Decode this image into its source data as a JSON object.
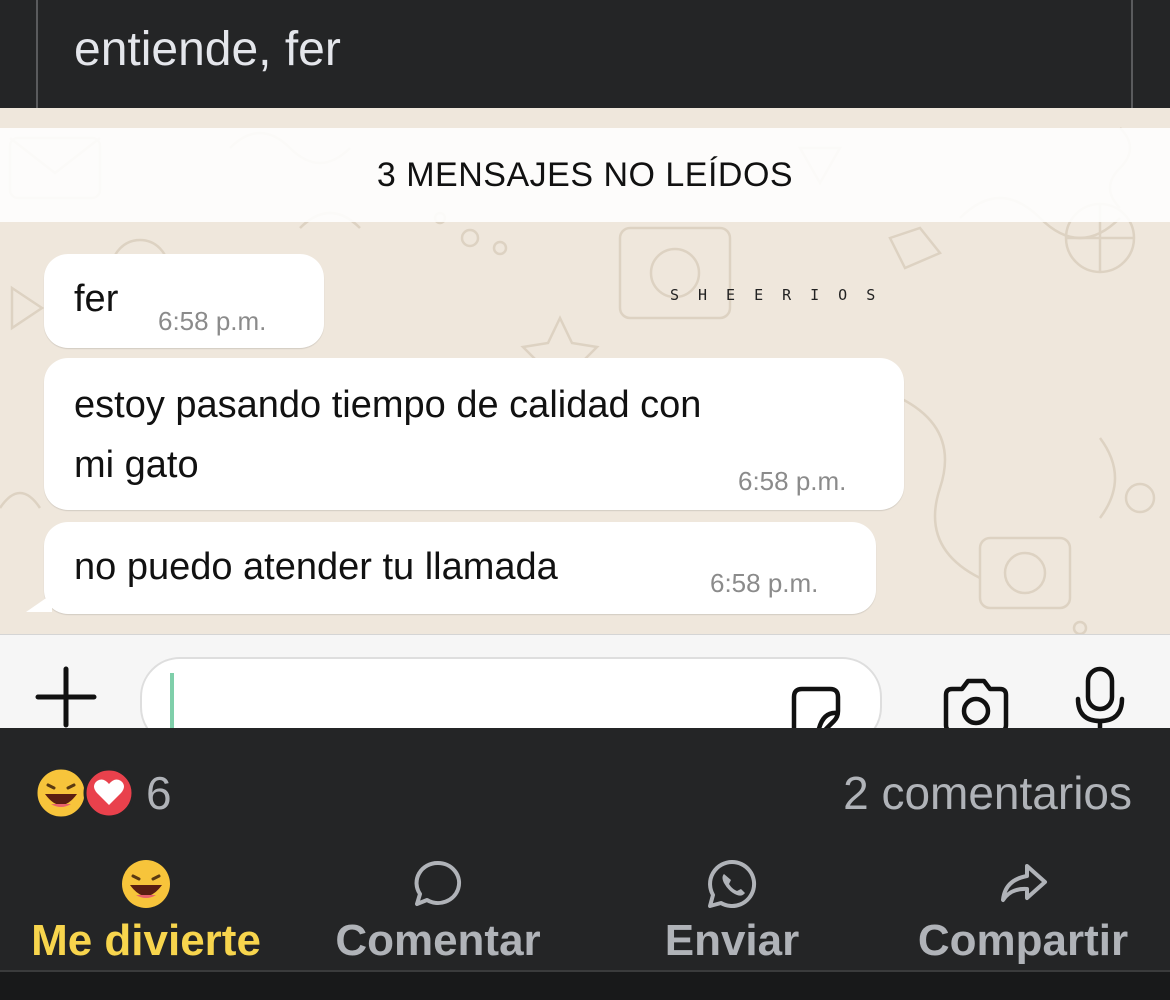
{
  "post": {
    "caption": "entiende, fer"
  },
  "chat": {
    "unread_banner": "3 MENSAJES NO LEÍDOS",
    "watermark": "SHEERIOS",
    "messages": [
      {
        "text": "fer",
        "time": "6:58 p.m."
      },
      {
        "text_line1": "estoy pasando tiempo de calidad con",
        "text_line2": "mi gato",
        "time": "6:58 p.m."
      },
      {
        "text": "no puedo atender tu llamada",
        "time": "6:58 p.m."
      }
    ],
    "input": {
      "value": "",
      "icons": [
        "plus-icon",
        "sticker-icon",
        "camera-icon",
        "microphone-icon"
      ]
    },
    "colors": {
      "background": "#efe7dc",
      "bubble": "#ffffff",
      "cursor": "#7fcfaa"
    }
  },
  "feedback": {
    "reactions": [
      "haha-emoji",
      "love-heart"
    ],
    "reaction_count": "6",
    "comments_label": "2 comentarios"
  },
  "actions": [
    {
      "label": "Me divierte",
      "icon": "haha-emoji-icon",
      "active": true,
      "color": "#f7d54d"
    },
    {
      "label": "Comentar",
      "icon": "comment-bubble-icon"
    },
    {
      "label": "Enviar",
      "icon": "whatsapp-icon"
    },
    {
      "label": "Compartir",
      "icon": "share-arrow-icon"
    }
  ]
}
